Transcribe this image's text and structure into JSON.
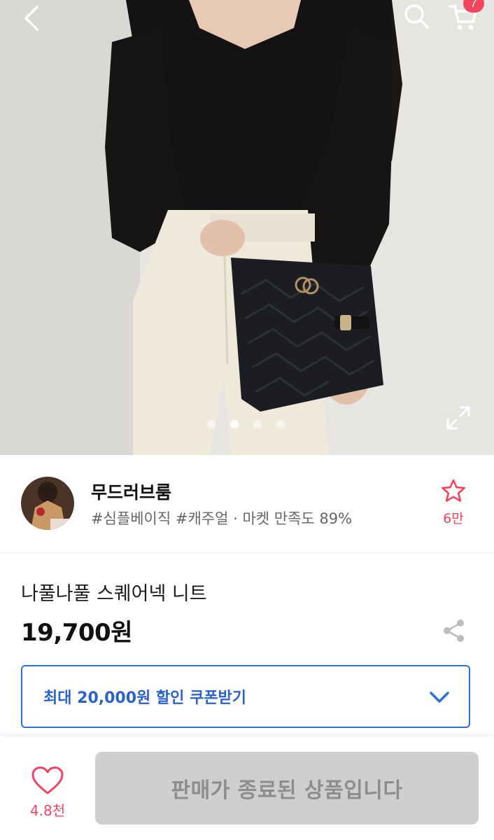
{
  "header": {
    "cart_count": "7",
    "icons": [
      "back-icon",
      "search-icon",
      "cart-icon",
      "expand-icon"
    ]
  },
  "carousel": {
    "total_slides": 4,
    "active_slide": 2
  },
  "shop": {
    "name": "무드러브룸",
    "tags": "#심플베이직 #캐주얼 · 마켓 만족도 89%",
    "favorite_count": "6만"
  },
  "product": {
    "name": "나풀나풀 스퀘어넥 니트",
    "price": "19,700원"
  },
  "coupon": {
    "label": "최대 20,000원 할인 쿠폰받기"
  },
  "bottom_bar": {
    "like_count": "4.8천",
    "status_button": "판매가 종료된 상품입니다"
  },
  "colors": {
    "accent_pink": "#f2445e",
    "coupon_blue": "#2f6fd9",
    "disabled_gray": "#cfcfcf"
  }
}
